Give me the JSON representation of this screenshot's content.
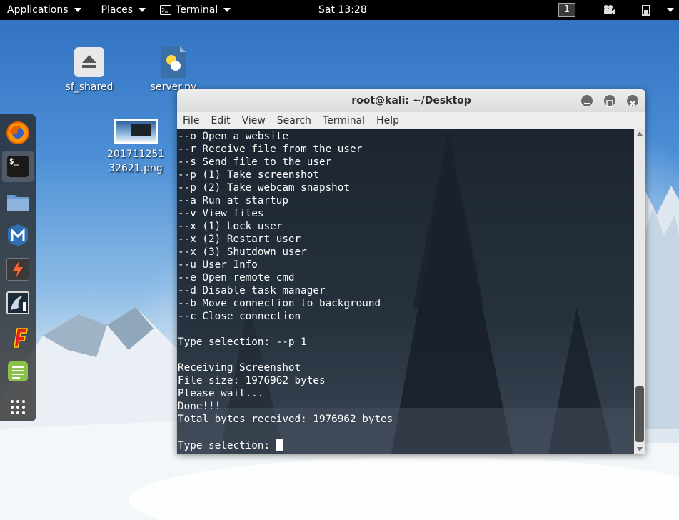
{
  "topbar": {
    "applications": "Applications",
    "places": "Places",
    "terminal": "Terminal",
    "clock": "Sat 13:28",
    "workspace": "1"
  },
  "desktop": {
    "icons": [
      {
        "label": "sf_shared",
        "icon": "eject-drive-icon"
      },
      {
        "label": "server.py",
        "icon": "python-file-icon"
      },
      {
        "label_line1": "201711251",
        "label_line2": "32621.png",
        "icon": "image-thumbnail-icon"
      }
    ]
  },
  "dock": {
    "items": [
      "firefox-icon",
      "terminal-icon",
      "files-icon",
      "metasploit-icon",
      "burpsuite-icon",
      "beef-icon",
      "faraday-icon",
      "leafpad-icon",
      "show-apps-icon"
    ]
  },
  "window": {
    "title": "root@kali: ~/Desktop",
    "menu": [
      "File",
      "Edit",
      "View",
      "Search",
      "Terminal",
      "Help"
    ]
  },
  "terminal": {
    "lines": [
      "--o Open a website",
      "--r Receive file from the user",
      "--s Send file to the user",
      "--p (1) Take screenshot",
      "--p (2) Take webcam snapshot",
      "--a Run at startup",
      "--v View files",
      "--x (1) Lock user",
      "--x (2) Restart user",
      "--x (3) Shutdown user",
      "--u User Info",
      "--e Open remote cmd",
      "--d Disable task manager",
      "--b Move connection to background",
      "--c Close connection",
      "",
      "Type selection: --p 1",
      "",
      "Receiving Screenshot",
      "File size: 1976962 bytes",
      "Please wait...",
      "Done!!!",
      "Total bytes received: 1976962 bytes",
      ""
    ],
    "prompt": "Type selection: "
  }
}
